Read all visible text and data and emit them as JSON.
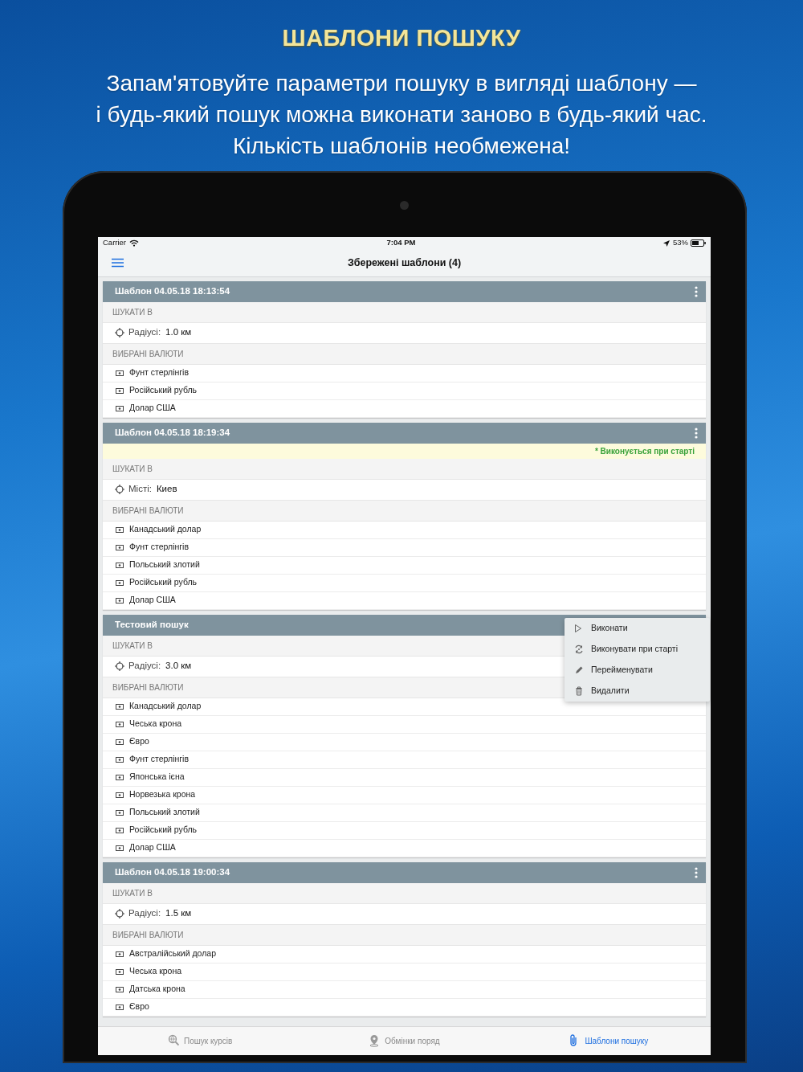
{
  "promo": {
    "title": "ШАБЛОНИ ПОШУКУ",
    "lines": [
      "Запам'ятовуйте параметри пошуку в вигляді шаблону —",
      "і будь-який пошук можна виконати заново в будь-який час.",
      "Кількість шаблонів необмежена!"
    ]
  },
  "status_bar": {
    "carrier": "Carrier",
    "time": "7:04 PM",
    "battery": "53%"
  },
  "navbar": {
    "title": "Збережені шаблони (4)"
  },
  "templates": [
    {
      "title": "Шаблон 04.05.18 18:13:54",
      "search_label": "ШУКАТИ В",
      "search_field": "Радіусі:",
      "search_value": "1.0 км",
      "currencies_label": "ВИБРАНІ ВАЛЮТИ",
      "currencies": [
        "Фунт стерлінгів",
        "Російський рубль",
        "Долар США"
      ]
    },
    {
      "title": "Шаблон 04.05.18 18:19:34",
      "notice": "* Виконується при старті",
      "search_label": "ШУКАТИ В",
      "search_field": "Місті:",
      "search_value": "Киев",
      "currencies_label": "ВИБРАНІ ВАЛЮТИ",
      "currencies": [
        "Канадський долар",
        "Фунт стерлінгів",
        "Польський злотий",
        "Російський рубль",
        "Долар США"
      ]
    },
    {
      "title": "Тестовий пошук",
      "search_label": "ШУКАТИ В",
      "search_field": "Радіусі:",
      "search_value": "3.0 км",
      "currencies_label": "ВИБРАНІ ВАЛЮТИ",
      "currencies": [
        "Канадський долар",
        "Чеська крона",
        "Євро",
        "Фунт стерлінгів",
        "Японська ієна",
        "Норвезька крона",
        "Польський злотий",
        "Російський рубль",
        "Долар США"
      ],
      "menu": [
        {
          "kind": "run",
          "label": "Виконати"
        },
        {
          "kind": "autostart",
          "label": "Виконувати при старті"
        },
        {
          "kind": "rename",
          "label": "Перейменувати"
        },
        {
          "kind": "delete",
          "label": "Видалити"
        }
      ]
    },
    {
      "title": "Шаблон 04.05.18 19:00:34",
      "search_label": "ШУКАТИ В",
      "search_field": "Радіусі:",
      "search_value": "1.5 км",
      "currencies_label": "ВИБРАНІ ВАЛЮТИ",
      "currencies": [
        "Австралійський долар",
        "Чеська крона",
        "Датська крона",
        "Євро"
      ]
    }
  ],
  "tab_bar": [
    {
      "kind": "rates",
      "label": "Пошук курсів",
      "selected": false
    },
    {
      "kind": "nearby",
      "label": "Обмінки поряд",
      "selected": false
    },
    {
      "kind": "templates",
      "label": "Шаблони пошуку",
      "selected": true
    }
  ]
}
